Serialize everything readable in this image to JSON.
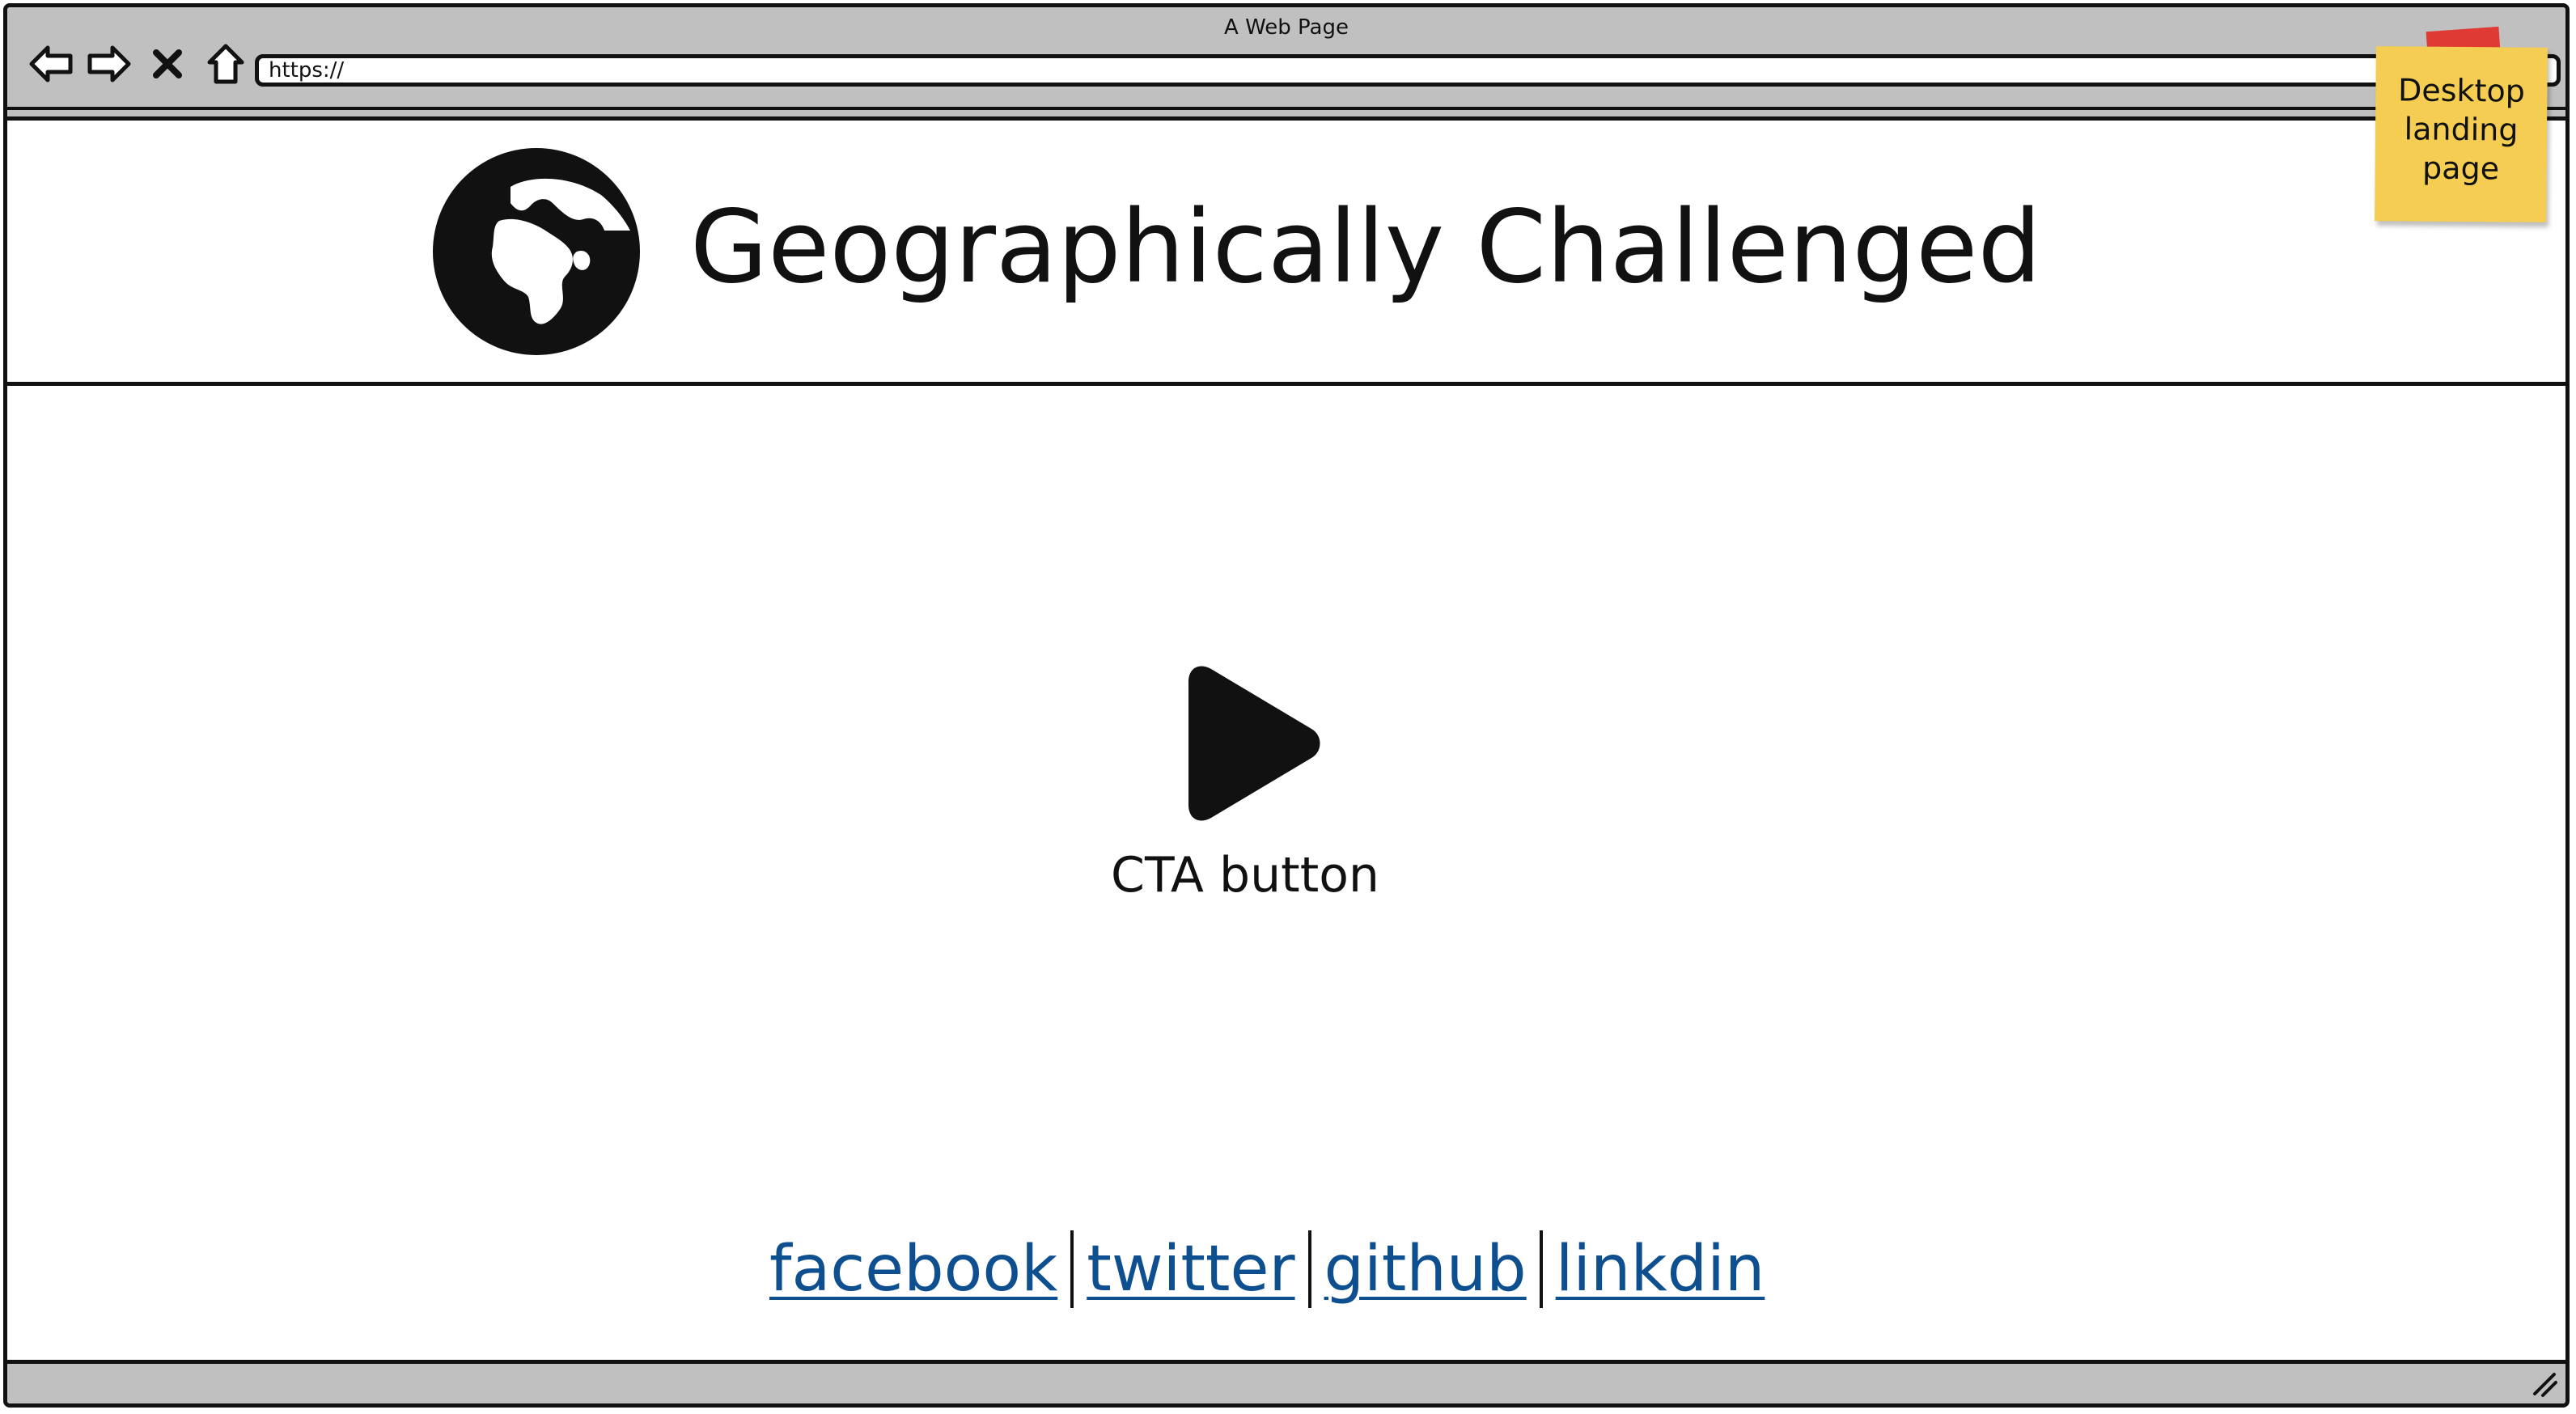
{
  "window": {
    "title": "A Web Page",
    "url": "https://"
  },
  "header": {
    "site_title": "Geographically Challenged",
    "logo_icon": "globe-icon"
  },
  "main": {
    "cta_icon": "play-icon",
    "cta_label": "CTA button"
  },
  "social_links": [
    {
      "label": "facebook"
    },
    {
      "label": "twitter"
    },
    {
      "label": "github"
    },
    {
      "label": "linkdin"
    }
  ],
  "sticky_note": {
    "text": "Desktop landing page"
  },
  "colors": {
    "link": "#0e4f8f",
    "chrome": "#c0c0c0",
    "sticky": "#f4cd52",
    "tape": "#e03a35"
  }
}
